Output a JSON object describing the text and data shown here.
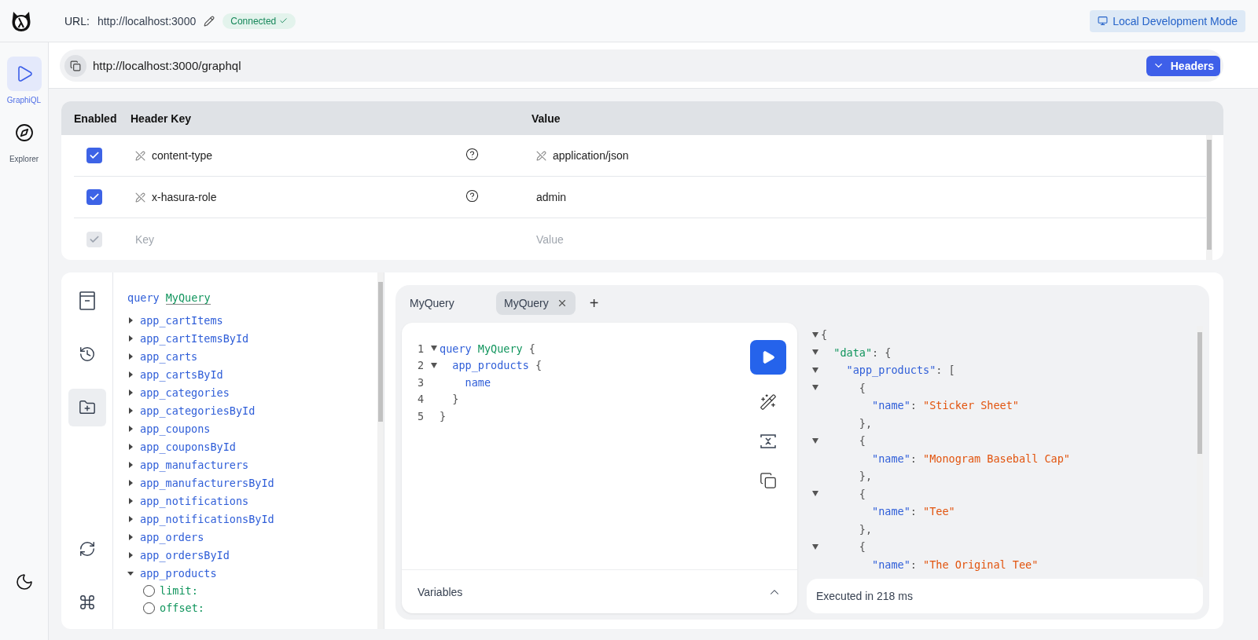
{
  "top_bar": {
    "url_label": "URL:",
    "url": "http://localhost:3000",
    "status": "Connected",
    "mode_button": "Local Development Mode"
  },
  "sidebar": {
    "items": [
      {
        "label": "GraphiQL",
        "kind": "graphiql",
        "selected": true
      },
      {
        "label": "Explorer",
        "kind": "explorer",
        "selected": false
      }
    ]
  },
  "endpoint": {
    "url": "http://localhost:3000/graphql",
    "headers_button": "Headers",
    "headers_expanded": true
  },
  "headers_table": {
    "columns": [
      "Enabled",
      "Header Key",
      "Value"
    ],
    "rows": [
      {
        "kind": "header",
        "enabled": true,
        "key": "content-type",
        "key_locked": true,
        "value": "application/json",
        "value_locked": true
      },
      {
        "kind": "header",
        "enabled": true,
        "key": "x-hasura-role",
        "key_locked": true,
        "value": "admin",
        "value_locked": false
      },
      {
        "kind": "new",
        "enabled": true,
        "key_placeholder": "Key",
        "value_placeholder": "Value"
      }
    ]
  },
  "tools": [
    {
      "kind": "docs",
      "selected": false
    },
    {
      "kind": "history",
      "selected": false
    },
    {
      "kind": "explorer",
      "selected": true
    },
    {
      "kind": "refetch",
      "selected": false
    },
    {
      "kind": "shortcuts",
      "selected": false
    }
  ],
  "explorer": {
    "keyword": "query",
    "operation": "MyQuery",
    "fields": [
      {
        "label": "app_cartItems",
        "expanded": false
      },
      {
        "label": "app_cartItemsById",
        "expanded": false
      },
      {
        "label": "app_carts",
        "expanded": false
      },
      {
        "label": "app_cartsById",
        "expanded": false
      },
      {
        "label": "app_categories",
        "expanded": false
      },
      {
        "label": "app_categoriesById",
        "expanded": false
      },
      {
        "label": "app_coupons",
        "expanded": false
      },
      {
        "label": "app_couponsById",
        "expanded": false
      },
      {
        "label": "app_manufacturers",
        "expanded": false
      },
      {
        "label": "app_manufacturersById",
        "expanded": false
      },
      {
        "label": "app_notifications",
        "expanded": false
      },
      {
        "label": "app_notificationsById",
        "expanded": false
      },
      {
        "label": "app_orders",
        "expanded": false
      },
      {
        "label": "app_ordersById",
        "expanded": false
      },
      {
        "label": "app_products",
        "expanded": true,
        "children": [
          {
            "label": "limit:",
            "checked": false
          },
          {
            "label": "offset:",
            "checked": false
          }
        ]
      }
    ]
  },
  "tabs": [
    {
      "label": "MyQuery",
      "selected": false,
      "closable": false
    },
    {
      "label": "MyQuery",
      "selected": true,
      "closable": true
    }
  ],
  "add_tab": "+",
  "editor": {
    "lines": [
      {
        "number": "1",
        "foldable": true,
        "tokens": [
          {
            "t": "query ",
            "kind": "keyword"
          },
          {
            "t": "MyQuery",
            "kind": "name"
          },
          {
            "t": " {",
            "kind": "punct"
          }
        ]
      },
      {
        "number": "2",
        "foldable": true,
        "tokens": [
          {
            "t": "  app_products",
            "kind": "field"
          },
          {
            "t": " {",
            "kind": "punct"
          }
        ]
      },
      {
        "number": "3",
        "foldable": false,
        "tokens": [
          {
            "t": "    name",
            "kind": "field"
          }
        ]
      },
      {
        "number": "4",
        "foldable": false,
        "tokens": [
          {
            "t": "  }",
            "kind": "punct"
          }
        ]
      },
      {
        "number": "5",
        "foldable": false,
        "tokens": [
          {
            "t": "}",
            "kind": "punct"
          }
        ]
      }
    ],
    "variables_label": "Variables",
    "variables_expanded": false
  },
  "result": {
    "lines": [
      {
        "foldable": true,
        "tokens": [
          {
            "t": "{",
            "kind": "punct"
          }
        ]
      },
      {
        "foldable": true,
        "tokens": [
          {
            "t": "  \"data\"",
            "kind": "name"
          },
          {
            "t": ": {",
            "kind": "punct"
          }
        ]
      },
      {
        "foldable": true,
        "tokens": [
          {
            "t": "    \"app_products\"",
            "kind": "field"
          },
          {
            "t": ": [",
            "kind": "punct"
          }
        ]
      },
      {
        "foldable": true,
        "tokens": [
          {
            "t": "      {",
            "kind": "punct"
          }
        ]
      },
      {
        "foldable": false,
        "tokens": [
          {
            "t": "        \"name\"",
            "kind": "field"
          },
          {
            "t": ": ",
            "kind": "punct"
          },
          {
            "t": "\"Sticker Sheet\"",
            "kind": "string"
          }
        ]
      },
      {
        "foldable": false,
        "tokens": [
          {
            "t": "      },",
            "kind": "punct"
          }
        ]
      },
      {
        "foldable": true,
        "tokens": [
          {
            "t": "      {",
            "kind": "punct"
          }
        ]
      },
      {
        "foldable": false,
        "tokens": [
          {
            "t": "        \"name\"",
            "kind": "field"
          },
          {
            "t": ": ",
            "kind": "punct"
          },
          {
            "t": "\"Monogram Baseball Cap\"",
            "kind": "string"
          }
        ]
      },
      {
        "foldable": false,
        "tokens": [
          {
            "t": "      },",
            "kind": "punct"
          }
        ]
      },
      {
        "foldable": true,
        "tokens": [
          {
            "t": "      {",
            "kind": "punct"
          }
        ]
      },
      {
        "foldable": false,
        "tokens": [
          {
            "t": "        \"name\"",
            "kind": "field"
          },
          {
            "t": ": ",
            "kind": "punct"
          },
          {
            "t": "\"Tee\"",
            "kind": "string"
          }
        ]
      },
      {
        "foldable": false,
        "tokens": [
          {
            "t": "      },",
            "kind": "punct"
          }
        ]
      },
      {
        "foldable": true,
        "tokens": [
          {
            "t": "      {",
            "kind": "punct"
          }
        ]
      },
      {
        "foldable": false,
        "tokens": [
          {
            "t": "        \"name\"",
            "kind": "field"
          },
          {
            "t": ": ",
            "kind": "punct"
          },
          {
            "t": "\"The Original Tee\"",
            "kind": "string"
          }
        ]
      }
    ],
    "footer": "Executed in 218 ms"
  }
}
